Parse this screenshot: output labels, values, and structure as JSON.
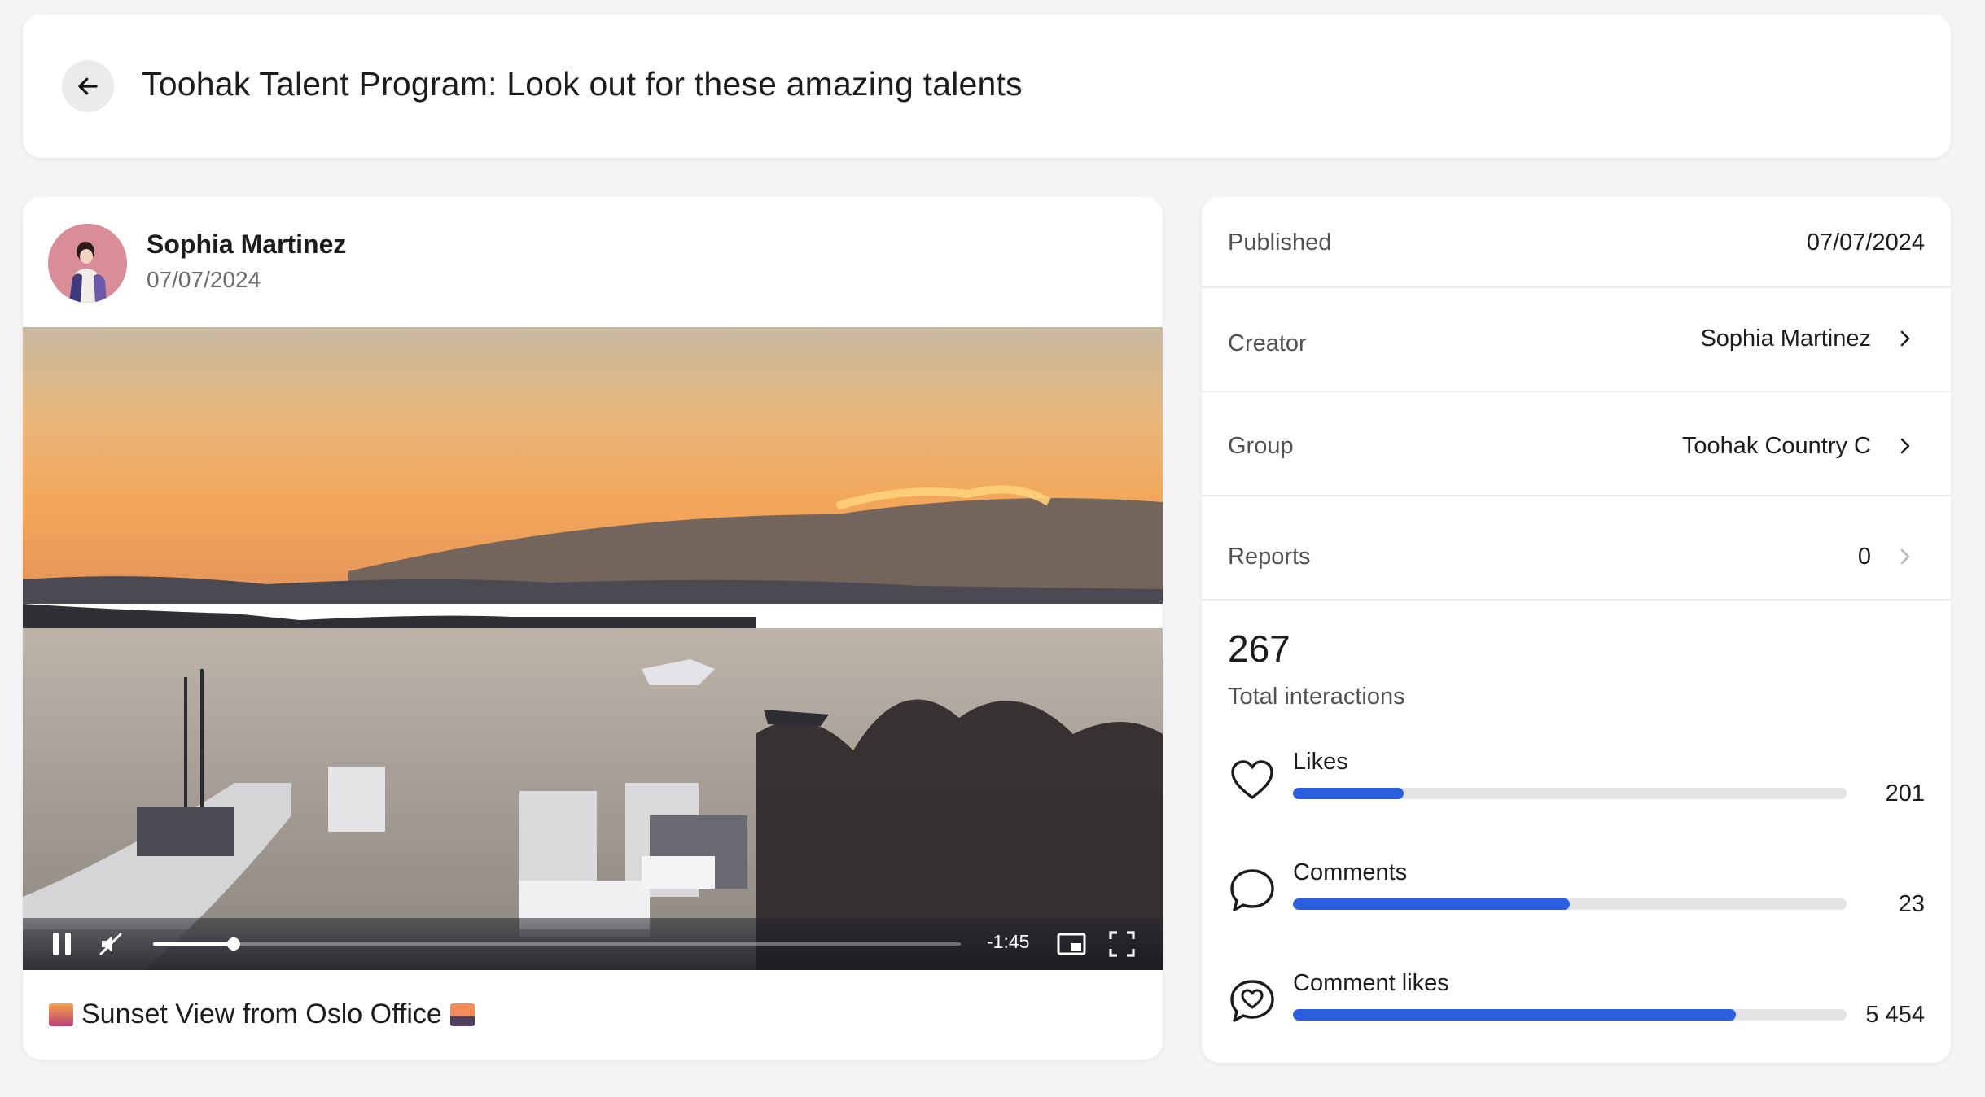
{
  "header": {
    "title": "Toohak Talent Program: Look out for these amazing talents",
    "back_icon": "arrow-left-icon"
  },
  "post": {
    "author_name": "Sophia Martinez",
    "date": "07/07/2024",
    "video": {
      "time_remaining": "-1:45",
      "progress": 0.1,
      "state": "playing",
      "muted": true
    },
    "caption": {
      "leading_emoji": "city-sunset-emoji",
      "text": "Sunset View from Oslo Office",
      "trailing_emoji": "sunrise-over-mountains-emoji"
    }
  },
  "details": {
    "published": {
      "label": "Published",
      "value": "07/07/2024"
    },
    "creator": {
      "label": "Creator",
      "value": "Sophia Martinez"
    },
    "group": {
      "label": "Group",
      "value": "Toohak Country C"
    },
    "reports": {
      "label": "Reports",
      "value": "0"
    },
    "total": {
      "value": "267",
      "label": "Total interactions"
    },
    "stats": [
      {
        "label": "Likes",
        "value": "201",
        "fraction": 0.2,
        "icon": "heart-icon"
      },
      {
        "label": "Comments",
        "value": "23",
        "fraction": 0.5,
        "icon": "comment-icon"
      },
      {
        "label": "Comment likes",
        "value": "5 454",
        "fraction": 0.8,
        "icon": "comment-heart-icon"
      }
    ]
  },
  "colors": {
    "accent": "#2b5fe0",
    "background": "#f4f4f5",
    "card": "#ffffff"
  }
}
